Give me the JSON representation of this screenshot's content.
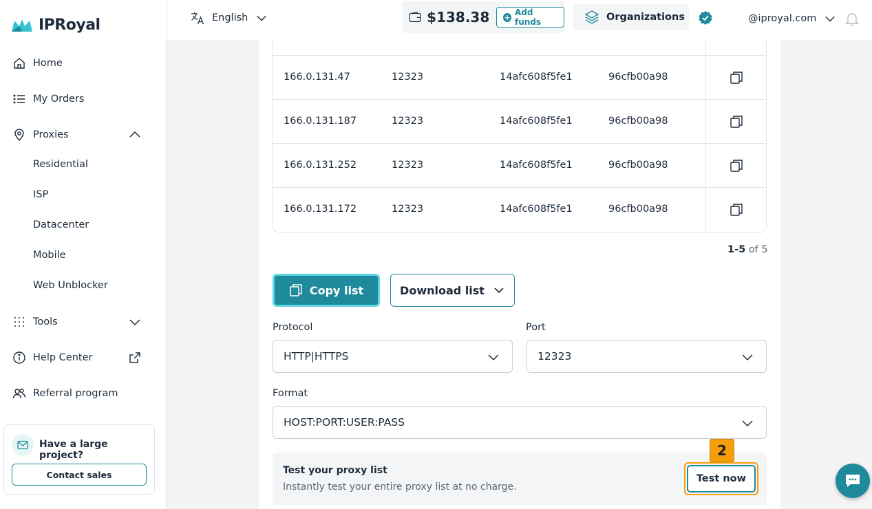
{
  "brand": {
    "name": "IPRoyal",
    "accent": "#1f8a9b"
  },
  "sidebar": {
    "items": [
      {
        "label": "Home",
        "icon": "home-icon"
      },
      {
        "label": "My Orders",
        "icon": "list-icon"
      },
      {
        "label": "Proxies",
        "icon": "location-pin-icon",
        "expanded": true
      },
      {
        "label": "Tools",
        "icon": "grid-dots-icon",
        "expanded": false
      },
      {
        "label": "Help Center",
        "icon": "info-icon"
      },
      {
        "label": "Referral program",
        "icon": "users-icon"
      }
    ],
    "proxy_subitems": [
      "Residential",
      "ISP",
      "Datacenter",
      "Mobile",
      "Web Unblocker"
    ],
    "promo": {
      "title": "Have a large project?",
      "button": "Contact sales"
    }
  },
  "header": {
    "language": "English",
    "balance": "$138.38",
    "add_funds": "Add funds",
    "organizations": "Organizations",
    "email": "@iproyal.com"
  },
  "proxy_table": {
    "rows": [
      {
        "ip": "166.0.131.47",
        "port": "12323",
        "user": "14afc608f5fe1",
        "pass": "96cfb00a98"
      },
      {
        "ip": "166.0.131.187",
        "port": "12323",
        "user": "14afc608f5fe1",
        "pass": "96cfb00a98"
      },
      {
        "ip": "166.0.131.252",
        "port": "12323",
        "user": "14afc608f5fe1",
        "pass": "96cfb00a98"
      },
      {
        "ip": "166.0.131.172",
        "port": "12323",
        "user": "14afc608f5fe1",
        "pass": "96cfb00a98"
      }
    ],
    "pagination_range": "1-5",
    "pagination_total": "of 5"
  },
  "actions": {
    "copy_list": "Copy list",
    "download_list": "Download list"
  },
  "form": {
    "protocol_label": "Protocol",
    "protocol_value": "HTTP|HTTPS",
    "port_label": "Port",
    "port_value": "12323",
    "format_label": "Format",
    "format_value": "HOST:PORT:USER:PASS"
  },
  "test": {
    "title": "Test your proxy list",
    "subtitle": "Instantly test your entire proxy list at no charge.",
    "button": "Test now",
    "step_badge": "2"
  }
}
